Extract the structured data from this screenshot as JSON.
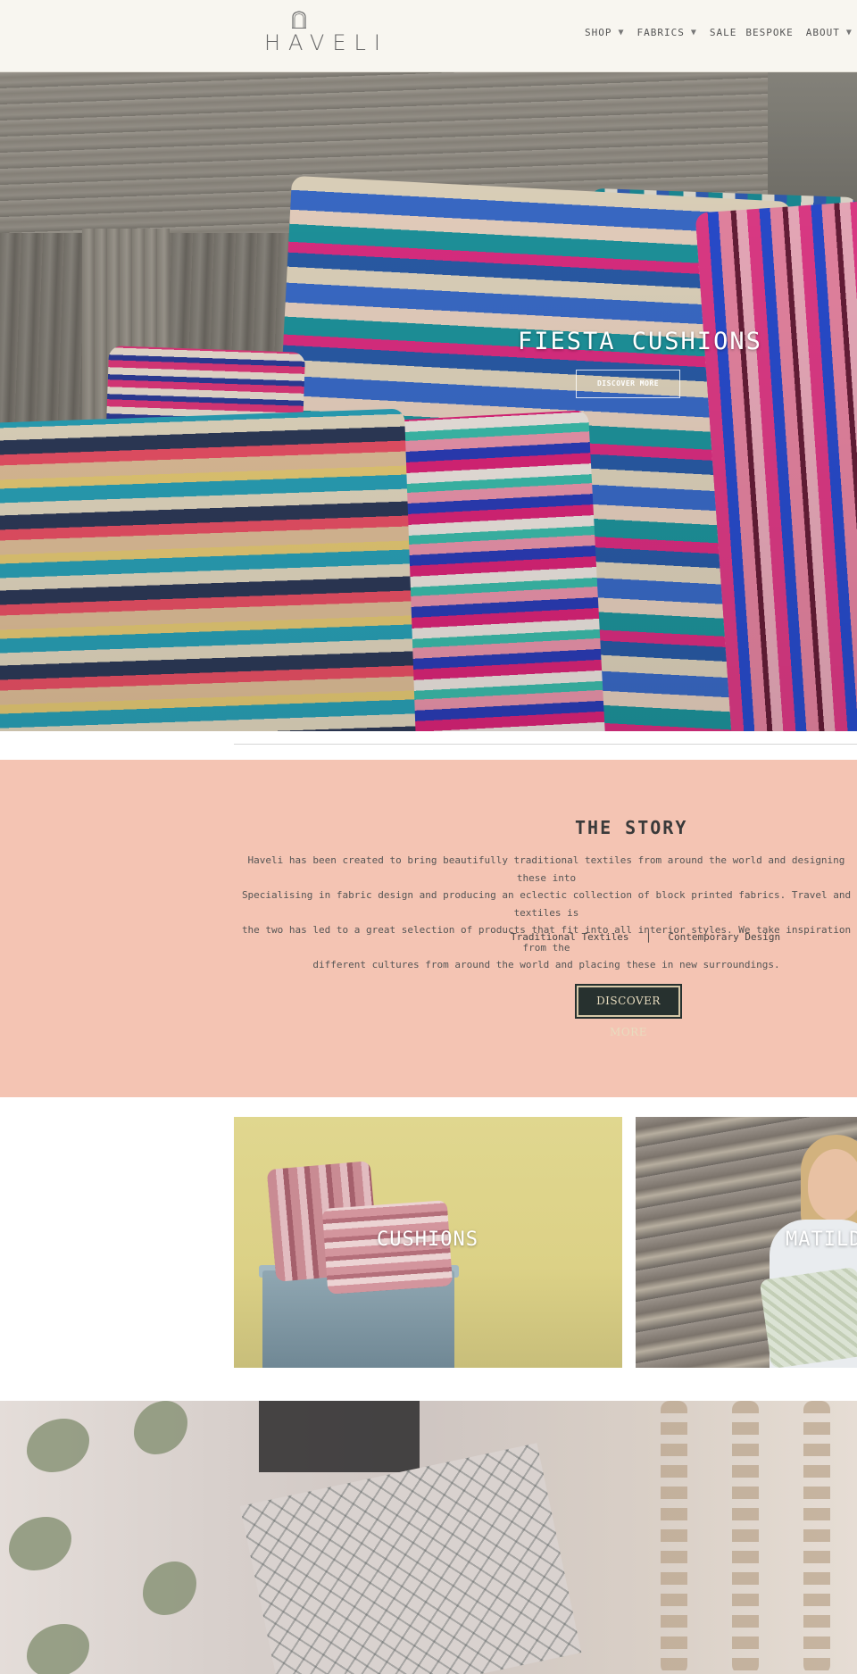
{
  "header": {
    "logo_text": "HAVELI",
    "nav": [
      {
        "label": "SHOP",
        "has_dropdown": true
      },
      {
        "label": "FABRICS",
        "has_dropdown": true
      },
      {
        "label": "SALE",
        "has_dropdown": false
      },
      {
        "label": "BESPOKE",
        "has_dropdown": false
      },
      {
        "label": "ABOUT",
        "has_dropdown": true
      }
    ],
    "caret_glyph": "▼"
  },
  "hero": {
    "title": "FIESTA CUSHIONS",
    "button_label": "DISCOVER MORE"
  },
  "story": {
    "title": "THE STORY",
    "lines": [
      "Haveli has been created to bring beautifully traditional textiles from around the world and designing these into",
      "Specialising in fabric design and producing an eclectic collection of block printed fabrics. Travel and textiles is",
      "the two has led to a great selection of products that fit into all interior styles. We take inspiration from the",
      "different cultures from around the world and placing these in new surroundings."
    ],
    "tags": [
      "Traditional Textiles",
      "Contemporary Design"
    ],
    "tag_separator": "|",
    "button_label": "DISCOVER MORE",
    "background_color": "#f4c4b3",
    "button_color": "#27312f"
  },
  "tiles": [
    {
      "label": "CUSHIONS"
    },
    {
      "label": "MATILD"
    }
  ]
}
